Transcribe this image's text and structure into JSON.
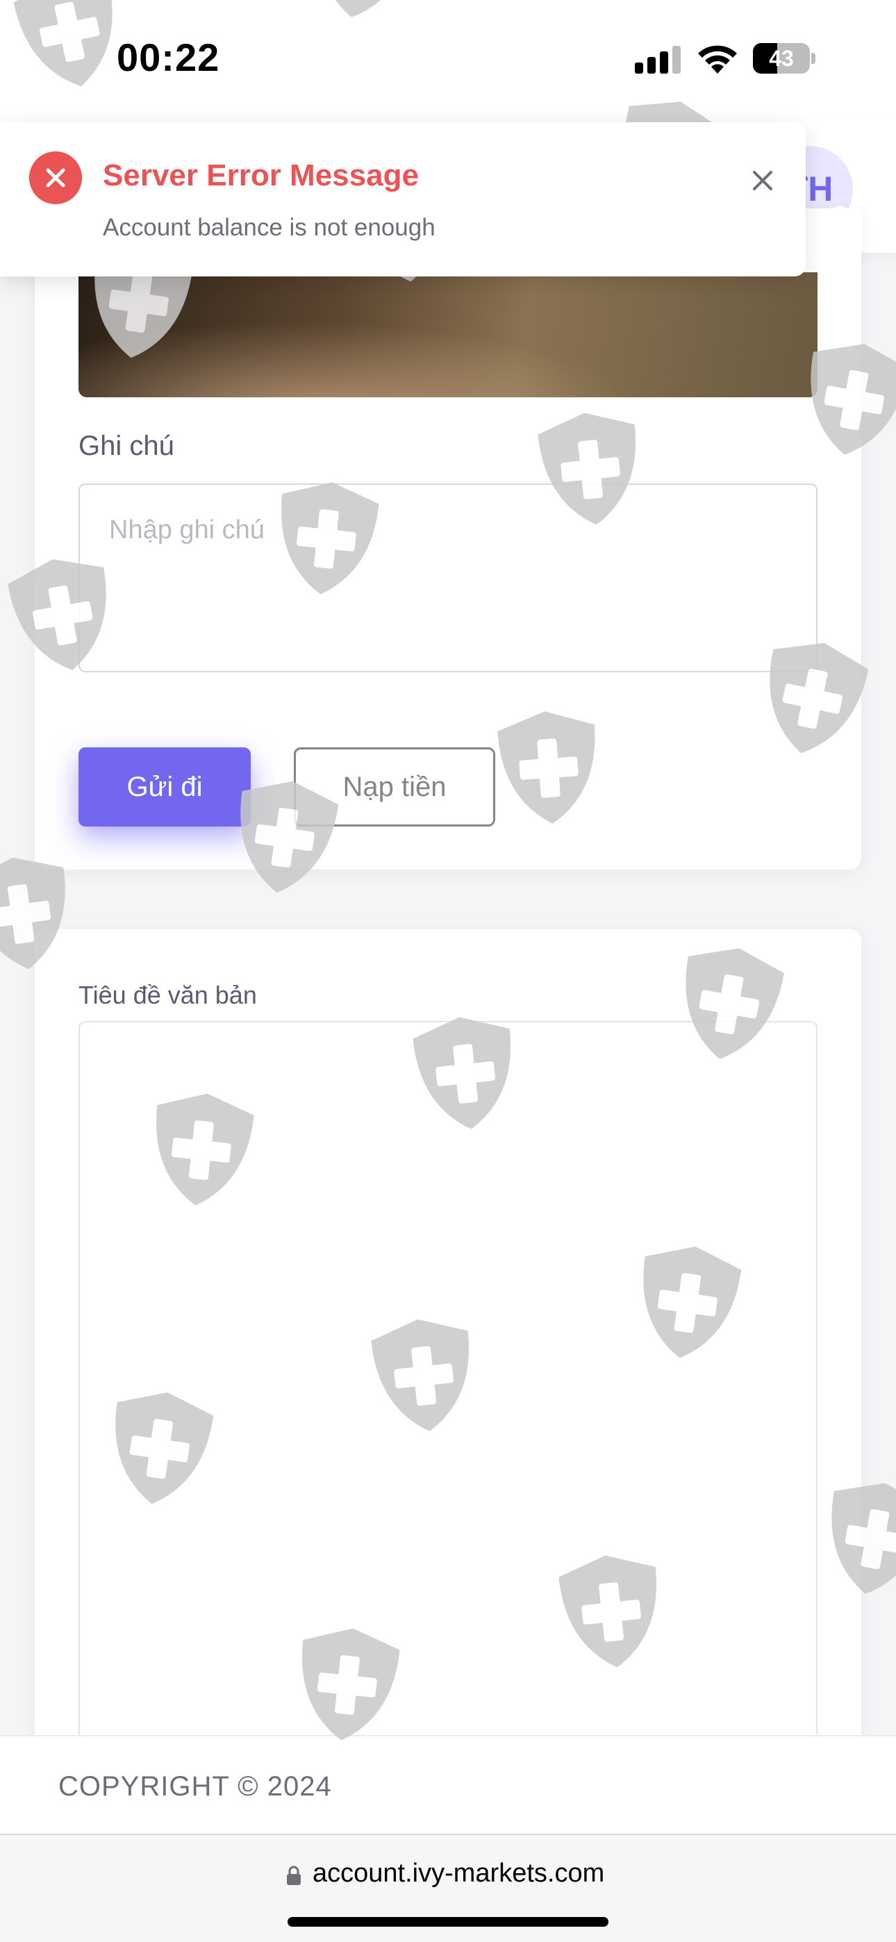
{
  "status_bar": {
    "time": "00:22",
    "battery_level": "43",
    "battery_fraction": 0.43
  },
  "header": {
    "avatar_initials": "TH"
  },
  "toast": {
    "title": "Server Error Message",
    "message": "Account balance is not enough"
  },
  "form": {
    "note_label": "Ghi chú",
    "note_placeholder": "Nhập ghi chú",
    "note_value": "",
    "submit_label": "Gửi đi",
    "deposit_label": "Nạp tiền"
  },
  "document": {
    "title_label": "Tiêu đề văn bản"
  },
  "footer": {
    "copyright": "COPYRIGHT © 2024"
  },
  "browser": {
    "url": "account.ivy-markets.com"
  },
  "colors": {
    "primary": "#7367f0",
    "danger": "#ea5455",
    "success": "#28c76f",
    "text": "#5e5873",
    "muted": "#82868b"
  },
  "icons": {
    "toast": "close-circle-icon",
    "toast_close": "close-icon",
    "url_lock": "lock-icon",
    "watermark": "shield-cross-icon"
  }
}
